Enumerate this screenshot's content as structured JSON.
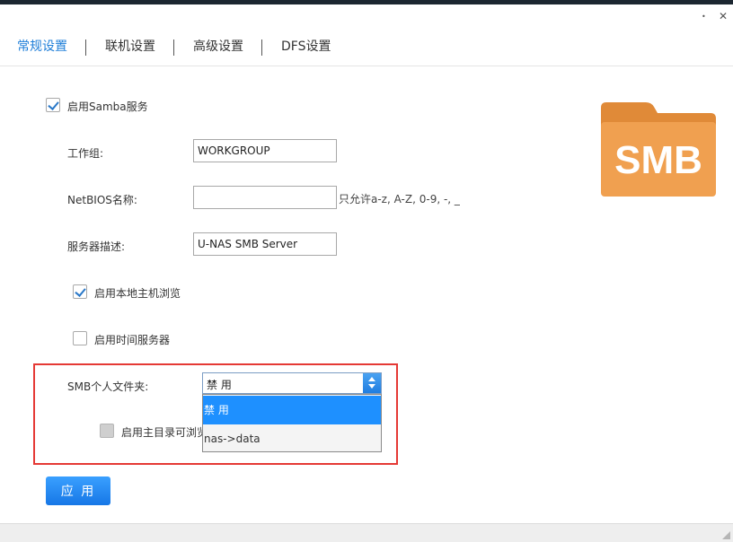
{
  "window": {
    "minimize_glyph": "•",
    "close_glyph": "✕"
  },
  "tabs": [
    {
      "label": "常规设置",
      "active": true
    },
    {
      "label": "联机设置"
    },
    {
      "label": "高级设置"
    },
    {
      "label": "DFS设置"
    }
  ],
  "form": {
    "enable_samba": {
      "label": "启用Samba服务",
      "checked": true
    },
    "workgroup": {
      "label": "工作组:",
      "value": "WORKGROUP"
    },
    "netbios": {
      "label": "NetBIOS名称:",
      "value": "",
      "hint": "只允许a-z, A-Z, 0-9, -, _"
    },
    "server_desc": {
      "label": "服务器描述:",
      "value": "U-NAS SMB Server"
    },
    "local_browse": {
      "label": "启用本地主机浏览",
      "checked": true
    },
    "time_server": {
      "label": "启用时间服务器",
      "checked": false
    },
    "personal_folder": {
      "label": "SMB个人文件夹:",
      "selected": "禁 用",
      "options": [
        "禁 用",
        "nas->data"
      ]
    },
    "home_browse": {
      "label": "启用主目录可浏览",
      "checked": false,
      "disabled": true
    },
    "apply_label": "应 用"
  },
  "logo": {
    "text": "SMB",
    "color": "#f0a050",
    "tab_color": "#e08a38"
  },
  "colors": {
    "accent": "#1e7ed8",
    "highlight_border": "#e53935",
    "selected_option": "#1e90ff"
  }
}
